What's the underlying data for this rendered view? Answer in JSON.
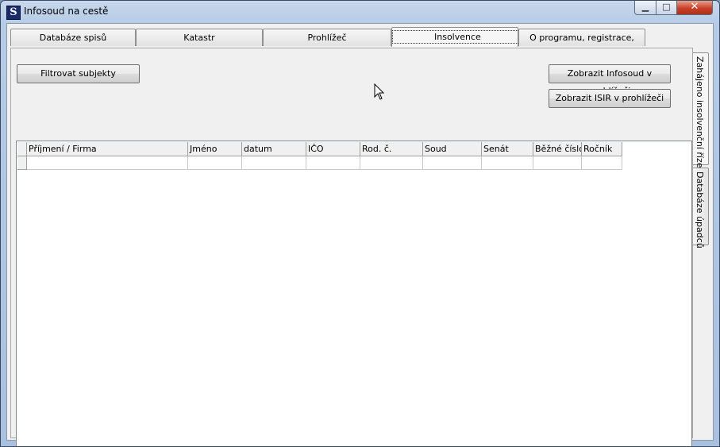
{
  "window": {
    "title": "Infosoud na cestě",
    "icon": "app-logo-icon"
  },
  "title_controls": {
    "minimize": "minimize-icon",
    "maximize": "maximize-icon",
    "close": "close-icon"
  },
  "tabs_top": [
    {
      "label": "Databáze spisů",
      "active": false
    },
    {
      "label": "Katastr",
      "active": false
    },
    {
      "label": "Prohlížeč",
      "active": false
    },
    {
      "label": "Insolvence",
      "active": true
    },
    {
      "label": "O programu, registrace, import",
      "active": false
    }
  ],
  "buttons": {
    "filter": "Filtrovat subjekty",
    "show_infosoud": "Zobrazit Infosoud v prohlížeči",
    "show_isir": "Zobrazit ISIR v prohlížeči"
  },
  "grid": {
    "columns": [
      "Příjmení / Firma",
      "Jméno",
      "datum",
      "IČO",
      "Rod. č.",
      "Soud",
      "Senát",
      "Běžné číslo",
      "Ročník"
    ],
    "rows": [
      [
        "",
        "",
        "",
        "",
        "",
        "",
        "",
        "",
        ""
      ]
    ]
  },
  "tabs_side": [
    {
      "label": "Zahájeno insolvenční řízení",
      "active": true
    },
    {
      "label": "Databáze úpadců",
      "active": false
    }
  ]
}
